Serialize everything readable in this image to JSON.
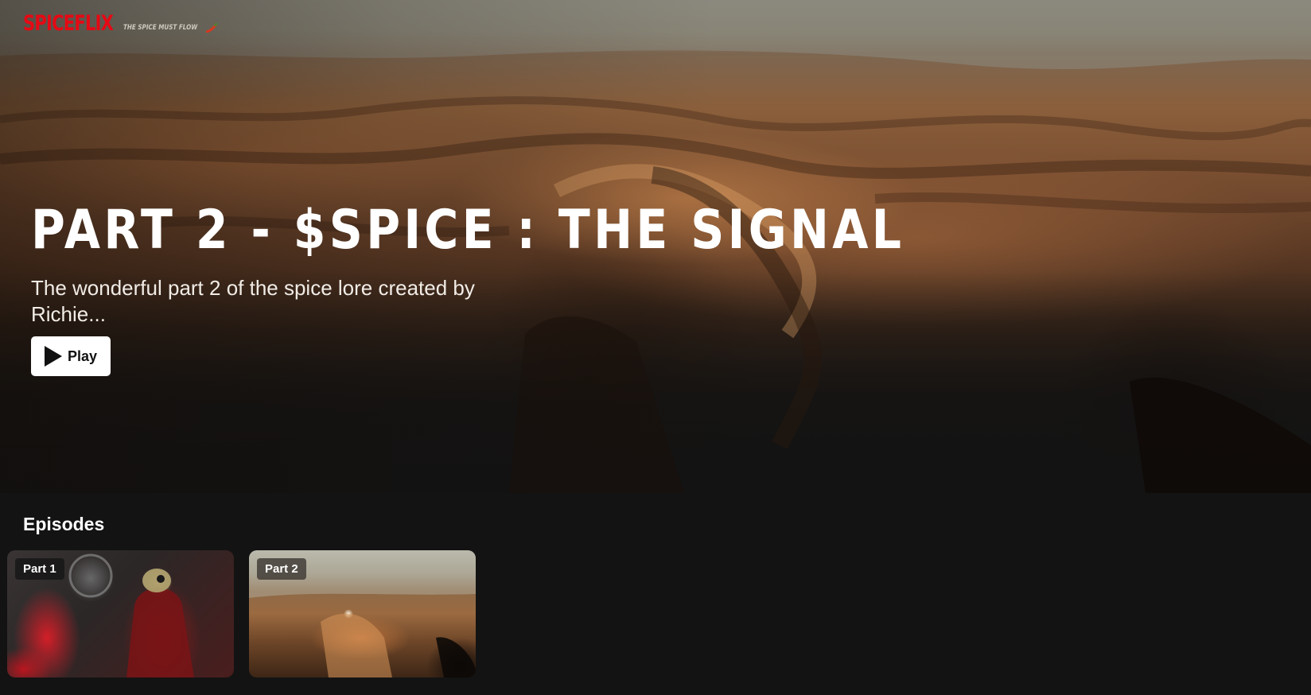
{
  "brand": {
    "name": "SPICEFLIX",
    "tagline": "THE SPICE MUST FLOW",
    "tagline_icon": "chili-pepper-icon",
    "color": "#e50914"
  },
  "hero": {
    "title": "PART 2 - $SPICE : THE SIGNAL",
    "description": "The wonderful part 2 of the spice lore created by Richie...",
    "play_label": "Play",
    "play_icon": "play-icon"
  },
  "episodes": {
    "heading": "Episodes",
    "items": [
      {
        "label": "Part 1"
      },
      {
        "label": "Part 2"
      }
    ]
  },
  "colors": {
    "background": "#131313",
    "text": "#ffffff",
    "play_button_bg": "#ffffff"
  }
}
